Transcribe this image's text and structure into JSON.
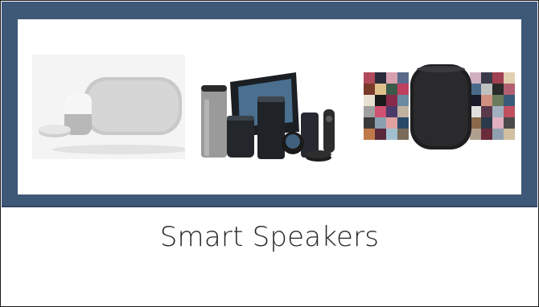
{
  "slide": {
    "caption": "Smart Speakers"
  },
  "colors": {
    "banner": "#3e5878",
    "photo_background": "#ffffff",
    "caption_text": "#262626"
  },
  "images": [
    {
      "name": "google-home-family",
      "icon": "google-home-speakers"
    },
    {
      "name": "amazon-echo-family",
      "icon": "amazon-echo-speakers"
    },
    {
      "name": "apple-homepod-collage",
      "icon": "apple-homepod-speaker"
    }
  ]
}
